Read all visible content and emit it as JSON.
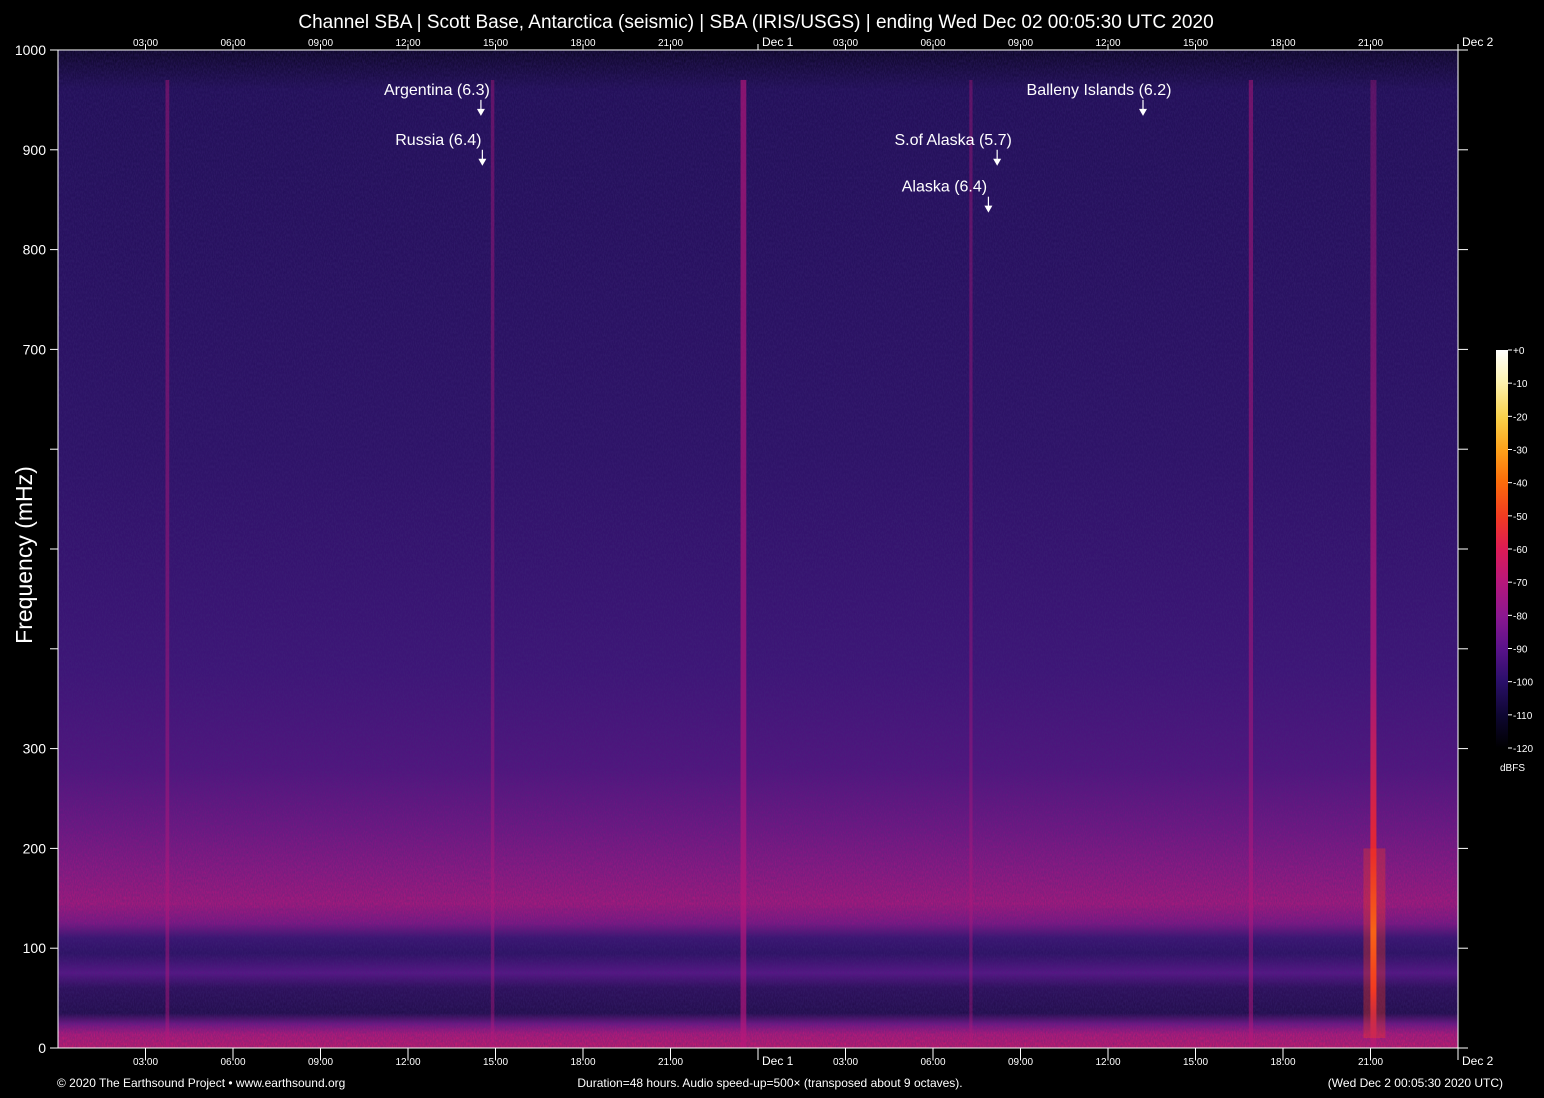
{
  "chart_data": {
    "type": "heatmap",
    "title": "Channel SBA | Scott Base, Antarctica (seismic) | SBA (IRIS/USGS) | ending Wed Dec 02 00:05:30 UTC 2020",
    "ylabel": "Frequency (mHz)",
    "xlabel": "",
    "ylim": [
      0,
      1000
    ],
    "yticks": [
      {
        "value": 0,
        "label": "0"
      },
      {
        "value": 100,
        "label": "100"
      },
      {
        "value": 200,
        "label": "200"
      },
      {
        "value": 300,
        "label": "300"
      },
      {
        "value": 400,
        "label": ""
      },
      {
        "value": 500,
        "label": ""
      },
      {
        "value": 600,
        "label": ""
      },
      {
        "value": 700,
        "label": "700"
      },
      {
        "value": 800,
        "label": "800"
      },
      {
        "value": 900,
        "label": "900"
      },
      {
        "value": 1000,
        "label": "1000"
      }
    ],
    "xlim_hours": [
      0,
      48
    ],
    "xticks": [
      {
        "hour": 3,
        "label": "03:00"
      },
      {
        "hour": 6,
        "label": "06:00"
      },
      {
        "hour": 9,
        "label": "09:00"
      },
      {
        "hour": 12,
        "label": "12:00"
      },
      {
        "hour": 15,
        "label": "15:00"
      },
      {
        "hour": 18,
        "label": "18:00"
      },
      {
        "hour": 21,
        "label": "21:00"
      },
      {
        "hour": 24,
        "label": "Dec  1"
      },
      {
        "hour": 27,
        "label": "03:00"
      },
      {
        "hour": 30,
        "label": "06:00"
      },
      {
        "hour": 33,
        "label": "09:00"
      },
      {
        "hour": 36,
        "label": "12:00"
      },
      {
        "hour": 39,
        "label": "15:00"
      },
      {
        "hour": 42,
        "label": "18:00"
      },
      {
        "hour": 45,
        "label": "21:00"
      },
      {
        "hour": 48,
        "label": "Dec  2"
      }
    ],
    "colorbar": {
      "label": "dBFS",
      "range": [
        -120,
        0
      ],
      "ticks": [
        "+0",
        "-10",
        "-20",
        "-30",
        "-40",
        "-50",
        "-60",
        "-70",
        "-80",
        "-90",
        "-100",
        "-110",
        "-120"
      ],
      "colors": [
        "#000000",
        "#0d0630",
        "#2b0f6b",
        "#5a128a",
        "#8a1790",
        "#b8177a",
        "#dd1b55",
        "#f23a22",
        "#fb6d0a",
        "#fda21b",
        "#f9d14a",
        "#fdf3b0",
        "#ffffff"
      ]
    },
    "annotations": [
      {
        "label": "Argentina (6.3)",
        "hour": 14.5,
        "freq": 935
      },
      {
        "label": "Russia (6.4)",
        "hour": 14.55,
        "freq": 885
      },
      {
        "label": "Balleny Islands (6.2)",
        "hour": 37.2,
        "freq": 935
      },
      {
        "label": "S.of Alaska (5.7)",
        "hour": 32.2,
        "freq": 885
      },
      {
        "label": "Alaska (6.4)",
        "hour": 31.9,
        "freq": 838
      }
    ],
    "events": [
      {
        "hour": 3.75,
        "intensity": 0.35
      },
      {
        "hour": 14.9,
        "intensity": 0.3
      },
      {
        "hour": 23.5,
        "intensity": 0.75
      },
      {
        "hour": 31.3,
        "intensity": 0.25
      },
      {
        "hour": 40.9,
        "intensity": 0.45
      },
      {
        "hour": 45.1,
        "intensity": 1.0
      }
    ]
  },
  "footer": {
    "left": "© 2020 The Earthsound Project • www.earthsound.org",
    "center": "Duration=48 hours. Audio speed-up=500× (transposed about 9 octaves).",
    "right": "(Wed Dec  2 00:05:30 2020 UTC)"
  }
}
